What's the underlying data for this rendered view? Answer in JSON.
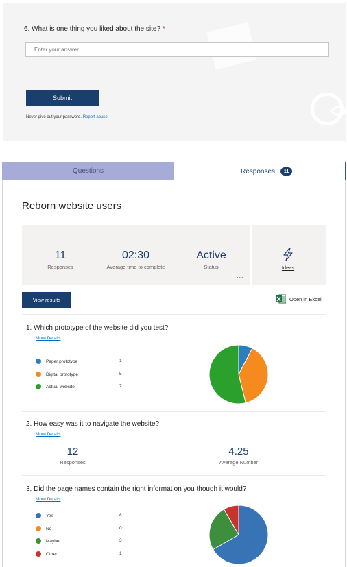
{
  "form": {
    "question_number": "6.",
    "question_text": "What is one thing you liked about the site?",
    "required_mark": "*",
    "answer_placeholder": "Enter your answer",
    "submit_label": "Submit",
    "footer_text": "Never give out your password.",
    "report_link": "Report abuse"
  },
  "tabs": {
    "questions_label": "Questions",
    "responses_label": "Responses",
    "responses_count": "11"
  },
  "summary": {
    "title": "Reborn website users",
    "responses_value": "11",
    "responses_label": "Responses",
    "time_value": "02:30",
    "time_label": "Average time to complete",
    "status_value": "Active",
    "status_label": "Status",
    "more_label": "...",
    "ideas_icon": "lightning-icon",
    "ideas_label": "Ideas",
    "view_results_label": "View results",
    "excel_icon": "excel-icon",
    "open_excel_label": "Open in Excel"
  },
  "questions": [
    {
      "number": "1.",
      "text": "Which prototype of the website did you test?",
      "more_details": "More Details",
      "options": [
        {
          "label": "Paper prototype",
          "count": "1",
          "color": "#2e7ebf"
        },
        {
          "label": "Digital prototype",
          "count": "5",
          "color": "#f58a1f"
        },
        {
          "label": "Actual website",
          "count": "7",
          "color": "#2ca02c"
        }
      ]
    },
    {
      "number": "2.",
      "text": "How easy was it to navigate the website?",
      "more_details": "More Details",
      "responses_value": "12",
      "responses_label": "Responses",
      "average_value": "4.25",
      "average_label": "Average Number"
    },
    {
      "number": "3.",
      "text": "Did the page names contain the right information you though it would?",
      "more_details": "More Details",
      "options": [
        {
          "label": "Yes",
          "count": "8",
          "color": "#3874b5"
        },
        {
          "label": "No",
          "count": "0",
          "color": "#f58a1f"
        },
        {
          "label": "Maybe",
          "count": "3",
          "color": "#3d8f3d"
        },
        {
          "label": "Other",
          "count": "1",
          "color": "#c8332e"
        }
      ]
    }
  ]
}
